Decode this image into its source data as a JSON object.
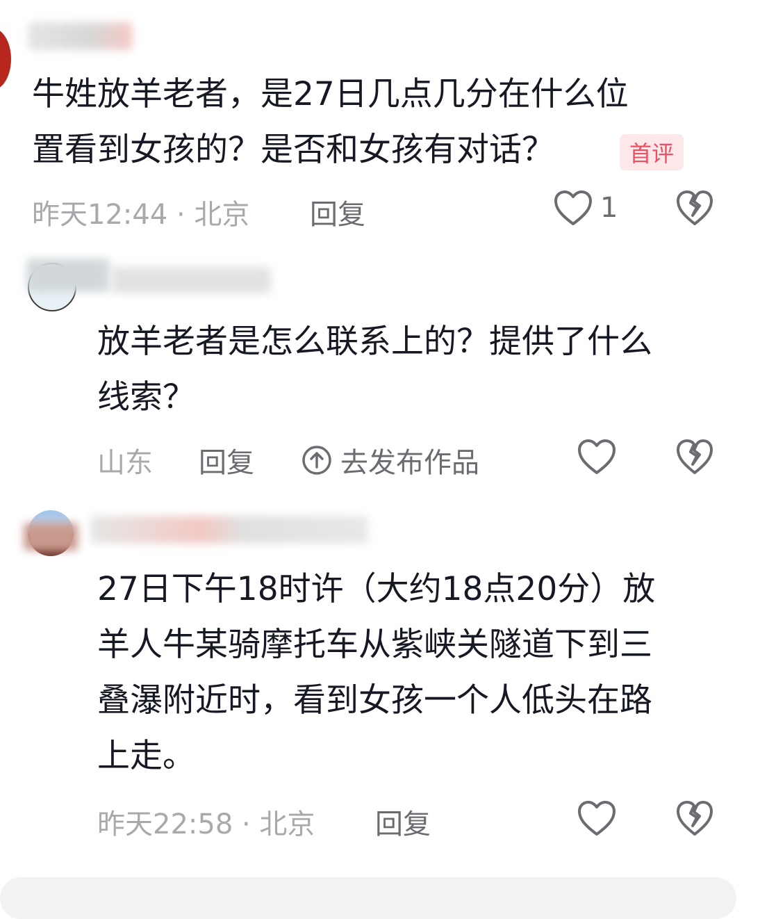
{
  "comments": [
    {
      "text": "牛姓放羊老者，是27日几点几分在什么位\n置看到女孩的？是否和女孩有对话？",
      "badge": "首评",
      "meta": "昨天12:44 · 北京",
      "reply": "回复",
      "likes": "1"
    },
    {
      "text": "放羊老者是怎么联系上的？提供了什么\n线索？",
      "meta": "山东",
      "reply": "回复",
      "publish": "去发布作品"
    },
    {
      "text": "27日下午18时许（大约18点20分）放\n羊人牛某骑摩托车从紫峡关隧道下到三\n叠瀑附近时，看到女孩一个人低头在路\n上走。",
      "meta": "昨天22:58 · 北京",
      "reply": "回复"
    }
  ],
  "icons": {
    "like": "heart-outline-icon",
    "dislike": "broken-heart-icon",
    "publish": "upload-arrow-icon"
  },
  "colors": {
    "text": "#161823",
    "meta": "#a9a9ad",
    "reply": "#6b6c72",
    "badge_bg": "#fde7e9",
    "badge_text": "#ee4f63"
  }
}
